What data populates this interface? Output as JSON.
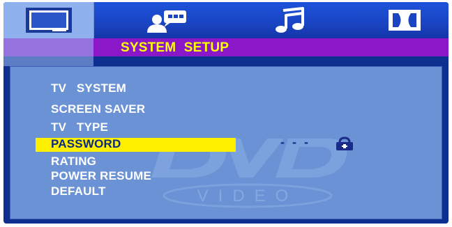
{
  "tabs": [
    {
      "name": "tv-screen-icon",
      "active": true
    },
    {
      "name": "user-chat-icon",
      "active": false
    },
    {
      "name": "music-note-icon",
      "active": false
    },
    {
      "name": "dolby-icon",
      "active": false
    }
  ],
  "header": {
    "title": "SYSTEM   SETUP"
  },
  "menu": {
    "items": [
      {
        "label": "TV   SYSTEM"
      },
      {
        "label": "SCREEN SAVER"
      },
      {
        "label": "TV   TYPE"
      },
      {
        "label": "PASSWORD"
      },
      {
        "label": "RATING"
      },
      {
        "label": "POWER RESUME"
      },
      {
        "label": "DEFAULT"
      }
    ],
    "selected_index": 3
  },
  "password": {
    "value": "- - -",
    "icon": "lock-icon"
  },
  "watermark": {
    "logo": "DVD",
    "sub": "VIDEO"
  },
  "colors": {
    "background": "#0d2f8f",
    "topbar": "#1a44c2",
    "titlebar": "#8a18c8",
    "title_text": "#ffff00",
    "panel": "#6a92d4",
    "highlight": "#fff000"
  }
}
